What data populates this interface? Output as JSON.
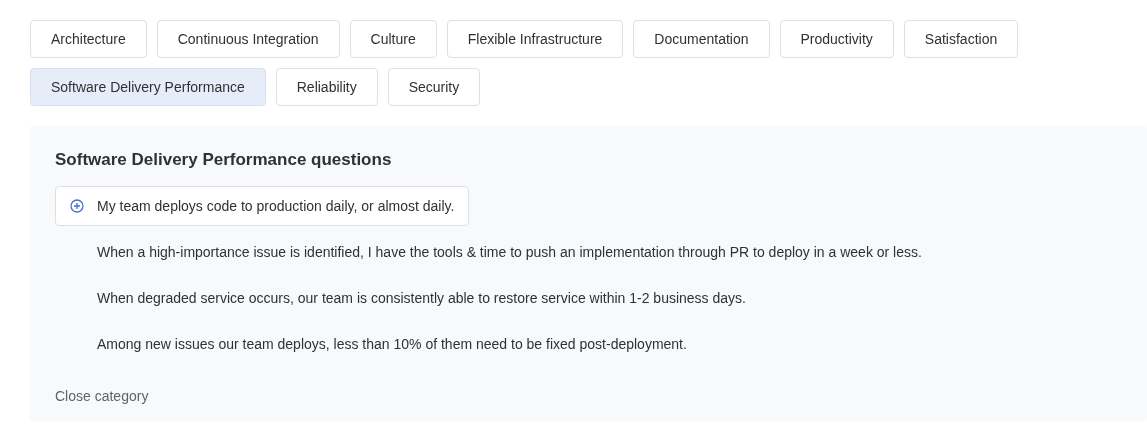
{
  "categories": [
    {
      "label": "Architecture",
      "selected": false
    },
    {
      "label": "Continuous Integration",
      "selected": false
    },
    {
      "label": "Culture",
      "selected": false
    },
    {
      "label": "Flexible Infrastructure",
      "selected": false
    },
    {
      "label": "Documentation",
      "selected": false
    },
    {
      "label": "Productivity",
      "selected": false
    },
    {
      "label": "Satisfaction",
      "selected": false
    },
    {
      "label": "Software Delivery Performance",
      "selected": true
    },
    {
      "label": "Reliability",
      "selected": false
    },
    {
      "label": "Security",
      "selected": false
    }
  ],
  "panel": {
    "title": "Software Delivery Performance questions",
    "questions": [
      {
        "text": "My team deploys code to production daily, or almost daily.",
        "highlighted": true
      },
      {
        "text": "When a high-importance issue is identified, I have the tools & time to push an implementation through PR to deploy in a week or less.",
        "highlighted": false
      },
      {
        "text": "When degraded service occurs, our team is consistently able to restore service within 1-2 business days.",
        "highlighted": false
      },
      {
        "text": "Among new issues our team deploys, less than 10% of them need to be fixed post-deployment.",
        "highlighted": false
      }
    ],
    "close_link": "Close category"
  }
}
